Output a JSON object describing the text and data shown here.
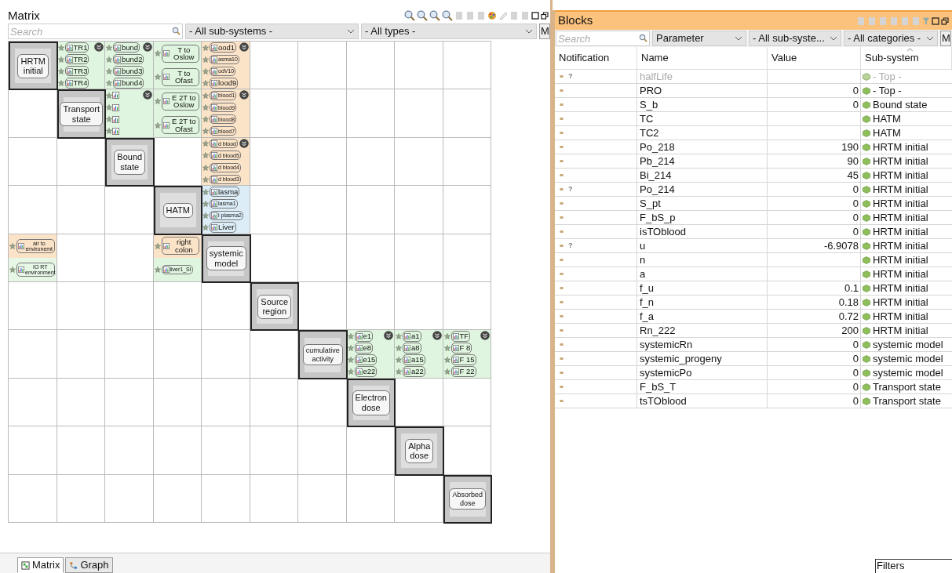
{
  "matrix": {
    "title": "Matrix",
    "search": {
      "placeholder": "Search"
    },
    "filters": [
      "- All sub-systems -",
      "- All types -"
    ],
    "cut_button": "M",
    "rows": [
      {
        "cells": [
          {
            "kind": "module",
            "label": "HRTM initial"
          },
          {
            "kind": "links",
            "more": true,
            "chips": [
              {
                "text": "TR1",
                "color": "#dff5df"
              },
              {
                "text": "TR2",
                "color": "#dff5df"
              },
              {
                "text": "TR3",
                "color": "#dff5df"
              },
              {
                "text": "TR4",
                "color": "#dff5df"
              }
            ]
          },
          {
            "kind": "links",
            "more": true,
            "chips": [
              {
                "text": "bund",
                "color": "#dff5df"
              },
              {
                "text": "bund2",
                "color": "#dff5df"
              },
              {
                "text": "bund3",
                "color": "#dff5df"
              },
              {
                "text": "bund4",
                "color": "#dff5df"
              }
            ]
          },
          {
            "kind": "links",
            "more": false,
            "chips": [
              {
                "text": "T to Oslow",
                "color": "#dff5df"
              },
              {
                "text": "T to Ofast",
                "color": "#dff5df"
              }
            ]
          },
          {
            "kind": "links",
            "more": true,
            "chips": [
              {
                "text": "ood1",
                "color": "#fbe3c8"
              },
              {
                "text": "asma10",
                "color": "#fbe3c8",
                "small": true
              },
              {
                "text": "odV10",
                "color": "#fbe3c8",
                "small": true
              },
              {
                "text": "lood9",
                "color": "#fbe3c8"
              }
            ]
          },
          {
            "kind": "empty"
          },
          {
            "kind": "empty"
          },
          {
            "kind": "empty"
          },
          {
            "kind": "empty"
          },
          {
            "kind": "empty"
          }
        ]
      },
      {
        "cells": [
          {
            "kind": "empty"
          },
          {
            "kind": "module",
            "label": "Transport state"
          },
          {
            "kind": "links",
            "more": true,
            "chips": [
              {
                "color": "#dff5df"
              },
              {
                "color": "#dff5df"
              },
              {
                "color": "#dff5df"
              },
              {
                "color": "#dff5df"
              }
            ]
          },
          {
            "kind": "links",
            "more": false,
            "chips": [
              {
                "text": "E 2T to Oslow",
                "color": "#dff5df"
              },
              {
                "text": "E 2T to Ofast",
                "color": "#dff5df"
              }
            ]
          },
          {
            "kind": "links",
            "more": true,
            "chips": [
              {
                "text": "blood1",
                "color": "#fbe3c8",
                "small": true
              },
              {
                "text": "blood9",
                "color": "#fbe3c8",
                "small": true
              },
              {
                "text": "blood8",
                "color": "#fbe3c8",
                "small": true
              },
              {
                "text": "blood7",
                "color": "#fbe3c8",
                "small": true
              }
            ]
          },
          {
            "kind": "empty"
          },
          {
            "kind": "empty"
          },
          {
            "kind": "empty"
          },
          {
            "kind": "empty"
          },
          {
            "kind": "empty"
          }
        ]
      },
      {
        "cells": [
          {
            "kind": "empty"
          },
          {
            "kind": "empty"
          },
          {
            "kind": "module",
            "label": "Bound state"
          },
          {
            "kind": "empty"
          },
          {
            "kind": "links",
            "more": true,
            "chips": [
              {
                "text": "d blood",
                "color": "#fbe3c8",
                "small": true
              },
              {
                "text": "d blood5",
                "color": "#fbe3c8",
                "small": true
              },
              {
                "text": "d blood4",
                "color": "#fbe3c8",
                "small": true
              },
              {
                "text": "d blood3",
                "color": "#fbe3c8",
                "small": true
              }
            ]
          },
          {
            "kind": "empty"
          },
          {
            "kind": "empty"
          },
          {
            "kind": "empty"
          },
          {
            "kind": "empty"
          },
          {
            "kind": "empty"
          }
        ]
      },
      {
        "cells": [
          {
            "kind": "empty"
          },
          {
            "kind": "empty"
          },
          {
            "kind": "empty"
          },
          {
            "kind": "module",
            "label": "HATM"
          },
          {
            "kind": "links",
            "more": false,
            "chips": [
              {
                "text": "lasma",
                "color": "#dcedf7"
              },
              {
                "text": "lasma1",
                "color": "#dcedf7",
                "small": true
              },
              {
                "text": "l plasma2",
                "color": "#dcedf7",
                "small": true
              },
              {
                "text": "Liver",
                "color": "#dcedf7"
              }
            ]
          },
          {
            "kind": "empty"
          },
          {
            "kind": "empty"
          },
          {
            "kind": "empty"
          },
          {
            "kind": "empty"
          },
          {
            "kind": "empty"
          }
        ]
      },
      {
        "cells": [
          {
            "kind": "links",
            "more": false,
            "chips": [
              {
                "text": "air to environemt",
                "color": "#fbe3c8",
                "small": true
              },
              {
                "text": "IO RT environment",
                "color": "#e6f7e6",
                "small": true
              }
            ]
          },
          {
            "kind": "empty"
          },
          {
            "kind": "empty"
          },
          {
            "kind": "links",
            "more": false,
            "chips": [
              {
                "text": "right colon",
                "color": "#fbe3c8"
              },
              {
                "text": "liver1_SI",
                "color": "#dff5df",
                "small": true
              }
            ]
          },
          {
            "kind": "module",
            "label": "systemic model"
          },
          {
            "kind": "empty"
          },
          {
            "kind": "empty"
          },
          {
            "kind": "empty"
          },
          {
            "kind": "empty"
          },
          {
            "kind": "empty"
          }
        ]
      },
      {
        "cells": [
          {
            "kind": "empty"
          },
          {
            "kind": "empty"
          },
          {
            "kind": "empty"
          },
          {
            "kind": "empty"
          },
          {
            "kind": "empty"
          },
          {
            "kind": "module",
            "label": "Source region"
          },
          {
            "kind": "empty"
          },
          {
            "kind": "empty"
          },
          {
            "kind": "empty"
          },
          {
            "kind": "empty"
          }
        ]
      },
      {
        "cells": [
          {
            "kind": "empty"
          },
          {
            "kind": "empty"
          },
          {
            "kind": "empty"
          },
          {
            "kind": "empty"
          },
          {
            "kind": "empty"
          },
          {
            "kind": "empty"
          },
          {
            "kind": "module",
            "label": "cumulative activity",
            "small": true
          },
          {
            "kind": "links",
            "more": true,
            "chips": [
              {
                "text": "e1",
                "color": "#dff5df"
              },
              {
                "text": "e8",
                "color": "#dff5df"
              },
              {
                "text": "e15",
                "color": "#dff5df"
              },
              {
                "text": "e22",
                "color": "#dff5df"
              }
            ]
          },
          {
            "kind": "links",
            "more": true,
            "chips": [
              {
                "text": "a1",
                "color": "#dff5df"
              },
              {
                "text": "a8",
                "color": "#dff5df"
              },
              {
                "text": "a15",
                "color": "#dff5df"
              },
              {
                "text": "a22",
                "color": "#dff5df"
              }
            ]
          },
          {
            "kind": "links",
            "more": true,
            "chips": [
              {
                "text": "TF",
                "color": "#dff5df"
              },
              {
                "text": "F 8",
                "color": "#dff5df"
              },
              {
                "text": "F 15",
                "color": "#dff5df"
              },
              {
                "text": "F 22",
                "color": "#dff5df"
              }
            ]
          }
        ]
      },
      {
        "cells": [
          {
            "kind": "empty"
          },
          {
            "kind": "empty"
          },
          {
            "kind": "empty"
          },
          {
            "kind": "empty"
          },
          {
            "kind": "empty"
          },
          {
            "kind": "empty"
          },
          {
            "kind": "empty"
          },
          {
            "kind": "module",
            "label": "Electron dose"
          },
          {
            "kind": "empty"
          },
          {
            "kind": "empty"
          }
        ]
      },
      {
        "cells": [
          {
            "kind": "empty"
          },
          {
            "kind": "empty"
          },
          {
            "kind": "empty"
          },
          {
            "kind": "empty"
          },
          {
            "kind": "empty"
          },
          {
            "kind": "empty"
          },
          {
            "kind": "empty"
          },
          {
            "kind": "empty"
          },
          {
            "kind": "module",
            "label": "Alpha dose"
          },
          {
            "kind": "empty"
          }
        ]
      },
      {
        "cells": [
          {
            "kind": "empty"
          },
          {
            "kind": "empty"
          },
          {
            "kind": "empty"
          },
          {
            "kind": "empty"
          },
          {
            "kind": "empty"
          },
          {
            "kind": "empty"
          },
          {
            "kind": "empty"
          },
          {
            "kind": "empty"
          },
          {
            "kind": "empty"
          },
          {
            "kind": "module",
            "label": "Absorbed dose",
            "small": true
          }
        ]
      }
    ],
    "tabs": [
      {
        "label": "Matrix",
        "selected": true
      },
      {
        "label": "Graph",
        "selected": false
      }
    ]
  },
  "blocks": {
    "title": "Blocks",
    "search": {
      "placeholder": "Search"
    },
    "filters": [
      "Parameter",
      "- All sub-syste...",
      "- All categories -"
    ],
    "cut_button": "M",
    "columns": [
      "Notification",
      "Name",
      "Value",
      "Sub-system"
    ],
    "rows": [
      {
        "flag": "?",
        "name": "halfLife",
        "subsystem": "- Top -",
        "disabled": true
      },
      {
        "name": "PRO",
        "value": "0",
        "subsystem": "- Top -",
        "disabled": false
      },
      {
        "name": "S_b",
        "value": "0",
        "subsystem": "Bound state",
        "disabled": false
      },
      {
        "name": "TC",
        "subsystem": "HATM",
        "disabled": false
      },
      {
        "name": "TC2",
        "subsystem": "HATM",
        "disabled": false
      },
      {
        "name": "Po_218",
        "value": "190",
        "subsystem": "HRTM initial",
        "disabled": false
      },
      {
        "name": "Pb_214",
        "value": "90",
        "subsystem": "HRTM initial",
        "disabled": false
      },
      {
        "name": "Bi_214",
        "value": "45",
        "subsystem": "HRTM initial",
        "disabled": false
      },
      {
        "flag": "?",
        "name": "Po_214",
        "value": "0",
        "subsystem": "HRTM initial",
        "disabled": false
      },
      {
        "name": "S_pt",
        "value": "0",
        "subsystem": "HRTM initial",
        "disabled": false
      },
      {
        "name": "F_bS_p",
        "value": "0",
        "subsystem": "HRTM initial",
        "disabled": false
      },
      {
        "name": "isTOblood",
        "value": "0",
        "subsystem": "HRTM initial",
        "disabled": false
      },
      {
        "flag": "?",
        "name": "u",
        "value": "-6.9078",
        "subsystem": "HRTM initial",
        "disabled": false
      },
      {
        "name": "n",
        "subsystem": "HRTM initial",
        "disabled": false
      },
      {
        "name": "a",
        "subsystem": "HRTM initial",
        "disabled": false
      },
      {
        "name": "f_u",
        "value": "0.1",
        "subsystem": "HRTM initial",
        "disabled": false
      },
      {
        "name": "f_n",
        "value": "0.18",
        "subsystem": "HRTM initial",
        "disabled": false
      },
      {
        "name": "f_a",
        "value": "0.72",
        "subsystem": "HRTM initial",
        "disabled": false
      },
      {
        "name": "Rn_222",
        "value": "200",
        "subsystem": "HRTM initial",
        "disabled": false
      },
      {
        "name": "systemicRn",
        "value": "0",
        "subsystem": "systemic model",
        "disabled": false
      },
      {
        "name": "systemic_progeny",
        "value": "0",
        "subsystem": "systemic model",
        "disabled": false
      },
      {
        "name": "systemicPo",
        "value": "0",
        "subsystem": "systemic model",
        "disabled": false
      },
      {
        "name": "F_bS_T",
        "value": "0",
        "subsystem": "Transport state",
        "disabled": false
      },
      {
        "name": "tsTOblood",
        "value": "0",
        "subsystem": "Transport state",
        "disabled": false
      }
    ],
    "footer": "Filters"
  }
}
